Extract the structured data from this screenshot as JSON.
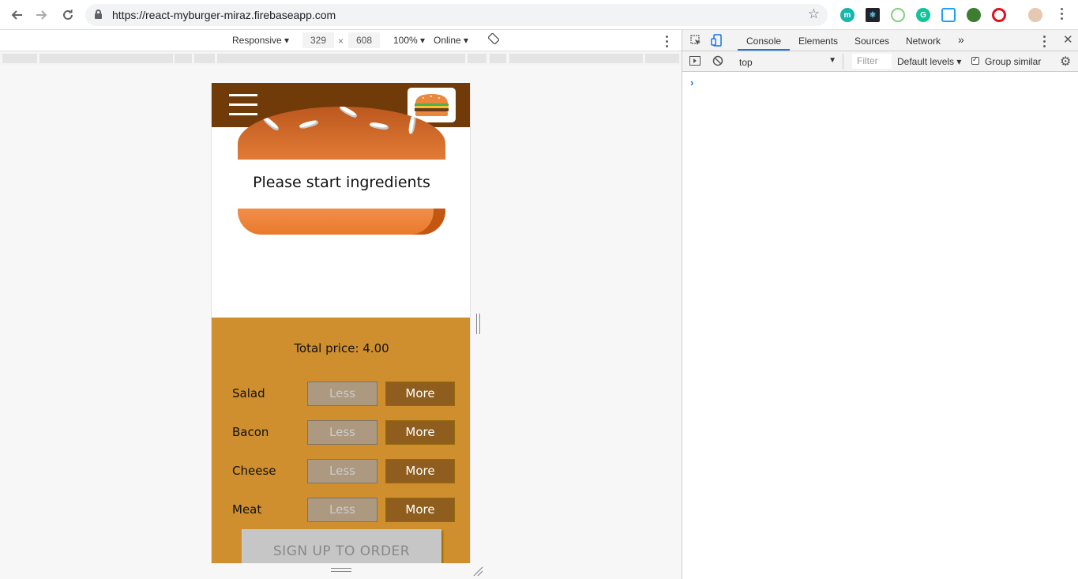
{
  "browser": {
    "url": "https://react-myburger-miraz.firebaseapp.com",
    "extensions": [
      "m"
    ]
  },
  "device_toolbar": {
    "mode": "Responsive",
    "width": "329",
    "times": "×",
    "height": "608",
    "zoom": "100%",
    "network": "Online"
  },
  "devtools": {
    "tabs": [
      "Console",
      "Elements",
      "Sources",
      "Network"
    ],
    "active_tab": "Console",
    "more_tabs": "»",
    "context": "top",
    "filter_placeholder": "Filter",
    "levels": "Default levels",
    "group_similar": "Group similar",
    "prompt": "›"
  },
  "app": {
    "burger_message": "Please start ingredients",
    "total_price_label": "Total price: 4.00",
    "controls": [
      {
        "label": "Salad",
        "less": "Less",
        "more": "More"
      },
      {
        "label": "Bacon",
        "less": "Less",
        "more": "More"
      },
      {
        "label": "Cheese",
        "less": "Less",
        "more": "More"
      },
      {
        "label": "Meat",
        "less": "Less",
        "more": "More"
      }
    ],
    "order_button": "SIGN UP TO ORDER"
  },
  "colors": {
    "toolbar": "#703b09",
    "controls_bg": "#cf8f2e",
    "more_button": "#8f5e1e",
    "less_button": "#ac9980",
    "devtools_accent": "#1a73e8"
  }
}
